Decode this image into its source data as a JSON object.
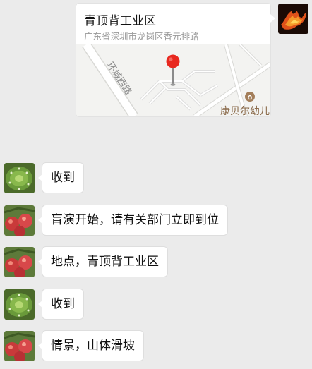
{
  "location_message": {
    "title": "青顶背工业区",
    "address": "广东省深圳市龙岗区香元排路",
    "map": {
      "road_label": "环城西路",
      "poi_label": "康贝尔幼儿",
      "poi_icon": "school-icon",
      "pin_icon": "location-pin-icon"
    }
  },
  "messages": [
    {
      "sender": "contact-a",
      "avatar": "cactus-avatar",
      "text": "收到"
    },
    {
      "sender": "contact-b",
      "avatar": "apples-avatar",
      "text": "盲演开始，请有关部门立即到位"
    },
    {
      "sender": "contact-b",
      "avatar": "apples-avatar",
      "text": "地点，青顶背工业区"
    },
    {
      "sender": "contact-a",
      "avatar": "cactus-avatar",
      "text": "收到"
    },
    {
      "sender": "contact-b",
      "avatar": "apples-avatar",
      "text": "情景，山体滑坡"
    }
  ],
  "colors": {
    "background": "#ebebeb",
    "bubble": "#ffffff",
    "pin": "#e8281f",
    "poi_text": "#8a6a4a"
  }
}
